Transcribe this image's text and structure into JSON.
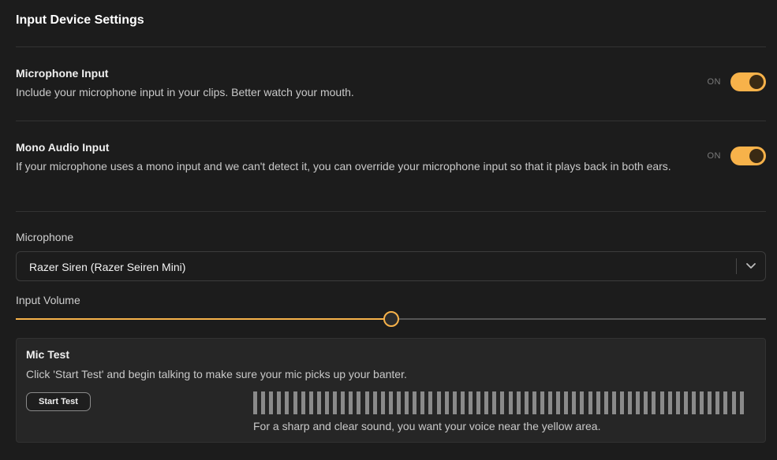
{
  "page": {
    "title": "Input Device Settings"
  },
  "settings": {
    "microphone_input": {
      "title": "Microphone Input",
      "description": "Include your microphone input in your clips. Better watch your mouth.",
      "state": "ON",
      "enabled": true
    },
    "mono_audio_input": {
      "title": "Mono Audio Input",
      "description": "If your microphone uses a mono input and we can't detect it, you can override your microphone input so that it plays back in both ears.",
      "state": "ON",
      "enabled": true
    }
  },
  "microphone": {
    "label": "Microphone",
    "selected": "Razer Siren (Razer Seiren Mini)"
  },
  "input_volume": {
    "label": "Input Volume",
    "value_fraction": 0.5
  },
  "mic_test": {
    "title": "Mic Test",
    "description": "Click 'Start Test' and begin talking to make sure your mic picks up your banter.",
    "button_label": "Start Test",
    "meter_bar_count": 62,
    "hint": "For a sharp and clear sound, you want your voice near the yellow area."
  },
  "colors": {
    "accent": "#f7b24a",
    "background": "#1c1c1c",
    "panel": "#262626"
  }
}
